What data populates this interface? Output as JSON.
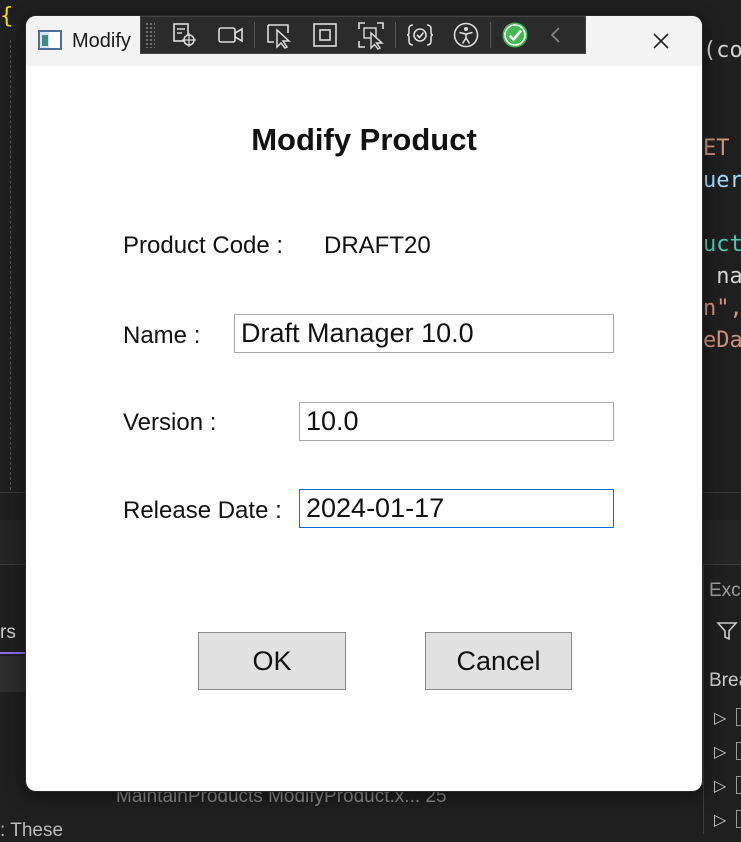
{
  "ide": {
    "code_brace": "{",
    "code_lines": [
      {
        "text": "(co",
        "color": "#d4d4d4"
      },
      {
        "text": "ET",
        "color": "#ce9178"
      },
      {
        "text": "uer",
        "color": "#9cdcfe"
      },
      {
        "text": "uct",
        "color": "#4ec9b0"
      },
      {
        "text": " na",
        "color": "#d4d4d4"
      },
      {
        "text": "n\",",
        "color": "#ce9178"
      },
      {
        "text": "eDa",
        "color": "#ce9178"
      }
    ],
    "tab_fragment": "rs",
    "status_line": "MaintainProducts  ModifyProduct.x...  25",
    "bottom_fragment": ": These",
    "right_panel_title": "Exce",
    "right_panel_label": "Brea"
  },
  "window": {
    "title": "Modify"
  },
  "toolbar": {
    "icons": [
      "select-element-icon",
      "record-icon",
      "pointer-select-icon",
      "frame-icon",
      "track-focus-icon",
      "binding-failures-icon",
      "accessibility-icon",
      "checkmark-icon",
      "collapse-icon"
    ]
  },
  "form": {
    "heading": "Modify Product",
    "product_code_label": "Product Code :",
    "product_code_value": "DRAFT20",
    "name_label": "Name :",
    "name_value": "Draft Manager 10.0",
    "version_label": "Version :",
    "version_value": "10.0",
    "release_date_label": "Release Date :",
    "release_date_value": "2024-01-17",
    "ok_label": "OK",
    "cancel_label": "Cancel"
  },
  "colors": {
    "accent": "#0a6fd6",
    "check_green": "#3fb950"
  }
}
